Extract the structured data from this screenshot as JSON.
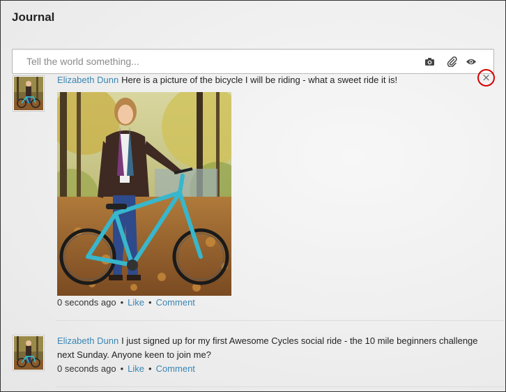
{
  "page": {
    "title": "Journal"
  },
  "composer": {
    "placeholder": "Tell the world something...",
    "icons": [
      "camera-icon",
      "paperclip-icon",
      "eye-icon"
    ]
  },
  "entries": [
    {
      "author": "Elizabeth Dunn",
      "text": "Here is a picture of the bicycle I will be riding - what a sweet ride it is!",
      "time": "0 seconds ago",
      "like_label": "Like",
      "comment_label": "Comment",
      "has_photo": true,
      "delete_label": "×"
    },
    {
      "author": "Elizabeth Dunn",
      "text_line1": "I just signed up for my first Awesome Cycles social ride - the 10 mile beginners challenge",
      "text_line2": "next Sunday. Anyone keen to join me?",
      "time": "0 seconds ago",
      "like_label": "Like",
      "comment_label": "Comment",
      "has_photo": false
    }
  ],
  "separator": "•",
  "colors": {
    "link": "#3a86b4",
    "highlight_ring": "#d60000",
    "background": "#ececec"
  }
}
